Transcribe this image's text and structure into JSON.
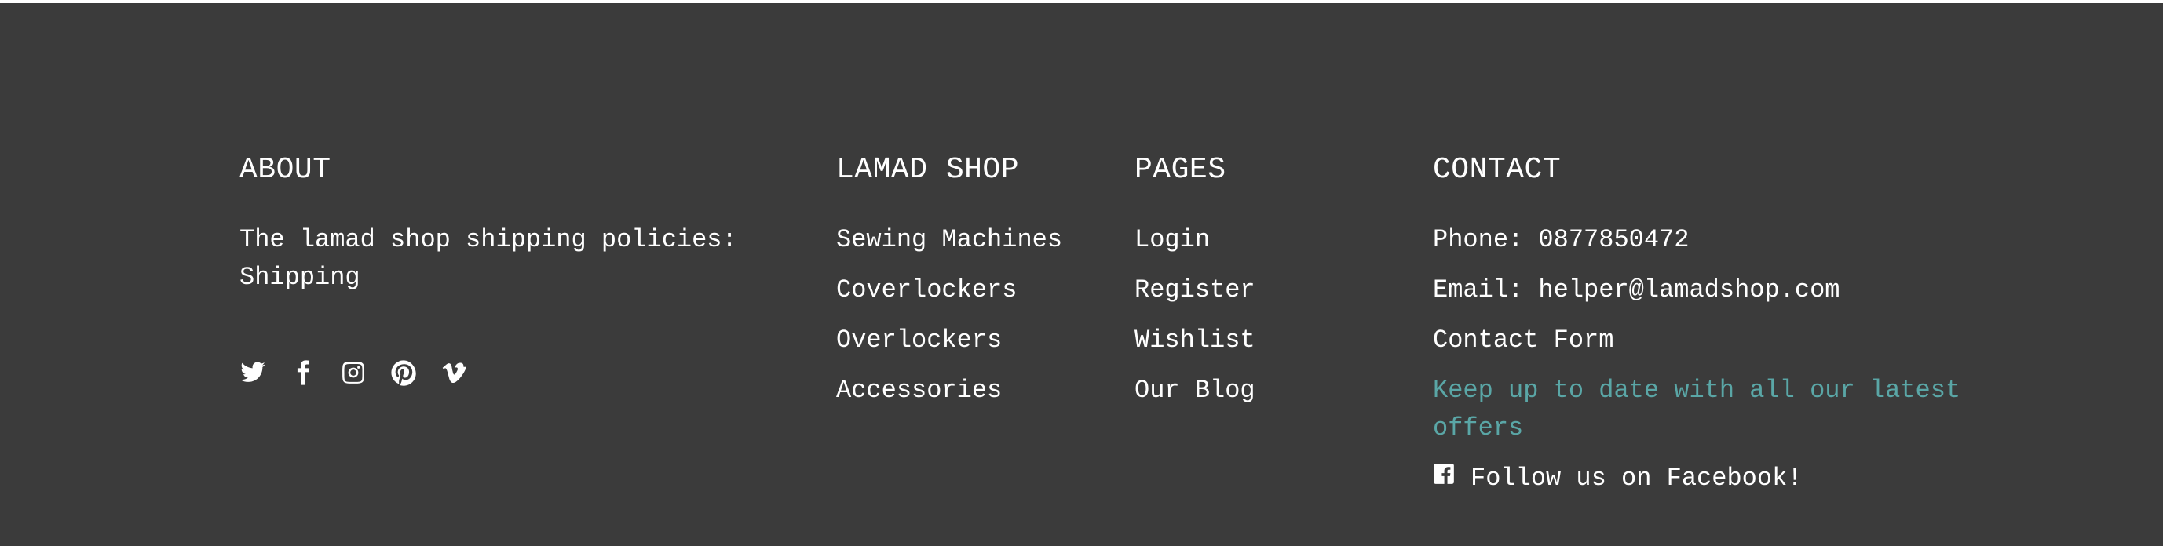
{
  "about": {
    "heading": "ABOUT",
    "text": "The lamad shop shipping policies: Shipping",
    "social_icons": [
      "twitter-icon",
      "facebook-icon",
      "instagram-icon",
      "pinterest-icon",
      "vimeo-icon"
    ]
  },
  "shop": {
    "heading": "LAMAD SHOP",
    "links": [
      "Sewing Machines",
      "Coverlockers",
      "Overlockers",
      "Accessories"
    ]
  },
  "pages": {
    "heading": "PAGES",
    "links": [
      "Login",
      "Register",
      "Wishlist",
      "Our Blog"
    ]
  },
  "contact": {
    "heading": "CONTACT",
    "phone": "Phone: 0877850472",
    "email": "Email: helper@lamadshop.com",
    "form_link": "Contact Form",
    "newsletter_text": "Keep up to date with all our latest offers",
    "facebook_text": "Follow us on Facebook!"
  },
  "colors": {
    "background": "#3b3b3b",
    "text": "#ffffff",
    "accent": "#5aa6a6"
  }
}
